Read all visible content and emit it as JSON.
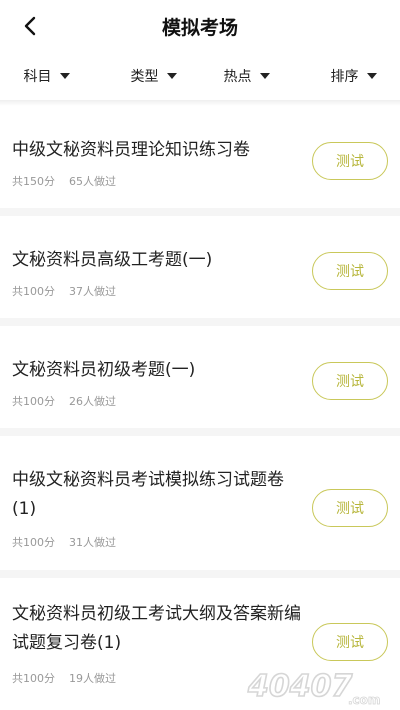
{
  "header": {
    "title": "模拟考场"
  },
  "filters": [
    {
      "label": "科目"
    },
    {
      "label": "类型"
    },
    {
      "label": "热点"
    },
    {
      "label": "排序"
    }
  ],
  "papers": [
    {
      "title": "中级文秘资料员理论知识练习卷",
      "score": "共150分",
      "takers": "65人做过",
      "action": "测试"
    },
    {
      "title": "文秘资料员高级工考题(一)",
      "score": "共100分",
      "takers": "37人做过",
      "action": "测试"
    },
    {
      "title": "文秘资料员初级考题(一)",
      "score": "共100分",
      "takers": "26人做过",
      "action": "测试"
    },
    {
      "title": "中级文秘资料员考试模拟练习试题卷(1)",
      "score": "共100分",
      "takers": "31人做过",
      "action": "测试"
    },
    {
      "title": "文秘资料员初级工考试大纲及答案新编试题复习卷(1)",
      "score": "共100分",
      "takers": "19人做过",
      "action": "测试"
    }
  ],
  "watermark": {
    "text": "40407",
    "suffix": ".com"
  },
  "colors": {
    "accent": "#c9c85a",
    "accent_text": "#b7b63b",
    "meta": "#999999",
    "divider": "#f5f5f5"
  }
}
